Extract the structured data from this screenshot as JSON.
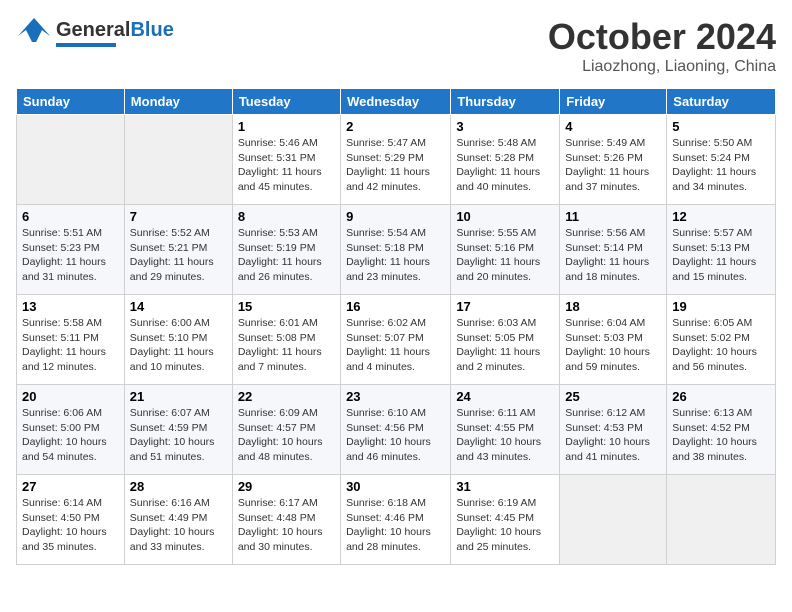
{
  "header": {
    "logo_general": "General",
    "logo_blue": "Blue",
    "month": "October 2024",
    "location": "Liaozhong, Liaoning, China"
  },
  "calendar": {
    "days_of_week": [
      "Sunday",
      "Monday",
      "Tuesday",
      "Wednesday",
      "Thursday",
      "Friday",
      "Saturday"
    ],
    "weeks": [
      [
        {
          "day": "",
          "sunrise": "",
          "sunset": "",
          "daylight": ""
        },
        {
          "day": "",
          "sunrise": "",
          "sunset": "",
          "daylight": ""
        },
        {
          "day": "1",
          "sunrise": "Sunrise: 5:46 AM",
          "sunset": "Sunset: 5:31 PM",
          "daylight": "Daylight: 11 hours and 45 minutes."
        },
        {
          "day": "2",
          "sunrise": "Sunrise: 5:47 AM",
          "sunset": "Sunset: 5:29 PM",
          "daylight": "Daylight: 11 hours and 42 minutes."
        },
        {
          "day": "3",
          "sunrise": "Sunrise: 5:48 AM",
          "sunset": "Sunset: 5:28 PM",
          "daylight": "Daylight: 11 hours and 40 minutes."
        },
        {
          "day": "4",
          "sunrise": "Sunrise: 5:49 AM",
          "sunset": "Sunset: 5:26 PM",
          "daylight": "Daylight: 11 hours and 37 minutes."
        },
        {
          "day": "5",
          "sunrise": "Sunrise: 5:50 AM",
          "sunset": "Sunset: 5:24 PM",
          "daylight": "Daylight: 11 hours and 34 minutes."
        }
      ],
      [
        {
          "day": "6",
          "sunrise": "Sunrise: 5:51 AM",
          "sunset": "Sunset: 5:23 PM",
          "daylight": "Daylight: 11 hours and 31 minutes."
        },
        {
          "day": "7",
          "sunrise": "Sunrise: 5:52 AM",
          "sunset": "Sunset: 5:21 PM",
          "daylight": "Daylight: 11 hours and 29 minutes."
        },
        {
          "day": "8",
          "sunrise": "Sunrise: 5:53 AM",
          "sunset": "Sunset: 5:19 PM",
          "daylight": "Daylight: 11 hours and 26 minutes."
        },
        {
          "day": "9",
          "sunrise": "Sunrise: 5:54 AM",
          "sunset": "Sunset: 5:18 PM",
          "daylight": "Daylight: 11 hours and 23 minutes."
        },
        {
          "day": "10",
          "sunrise": "Sunrise: 5:55 AM",
          "sunset": "Sunset: 5:16 PM",
          "daylight": "Daylight: 11 hours and 20 minutes."
        },
        {
          "day": "11",
          "sunrise": "Sunrise: 5:56 AM",
          "sunset": "Sunset: 5:14 PM",
          "daylight": "Daylight: 11 hours and 18 minutes."
        },
        {
          "day": "12",
          "sunrise": "Sunrise: 5:57 AM",
          "sunset": "Sunset: 5:13 PM",
          "daylight": "Daylight: 11 hours and 15 minutes."
        }
      ],
      [
        {
          "day": "13",
          "sunrise": "Sunrise: 5:58 AM",
          "sunset": "Sunset: 5:11 PM",
          "daylight": "Daylight: 11 hours and 12 minutes."
        },
        {
          "day": "14",
          "sunrise": "Sunrise: 6:00 AM",
          "sunset": "Sunset: 5:10 PM",
          "daylight": "Daylight: 11 hours and 10 minutes."
        },
        {
          "day": "15",
          "sunrise": "Sunrise: 6:01 AM",
          "sunset": "Sunset: 5:08 PM",
          "daylight": "Daylight: 11 hours and 7 minutes."
        },
        {
          "day": "16",
          "sunrise": "Sunrise: 6:02 AM",
          "sunset": "Sunset: 5:07 PM",
          "daylight": "Daylight: 11 hours and 4 minutes."
        },
        {
          "day": "17",
          "sunrise": "Sunrise: 6:03 AM",
          "sunset": "Sunset: 5:05 PM",
          "daylight": "Daylight: 11 hours and 2 minutes."
        },
        {
          "day": "18",
          "sunrise": "Sunrise: 6:04 AM",
          "sunset": "Sunset: 5:03 PM",
          "daylight": "Daylight: 10 hours and 59 minutes."
        },
        {
          "day": "19",
          "sunrise": "Sunrise: 6:05 AM",
          "sunset": "Sunset: 5:02 PM",
          "daylight": "Daylight: 10 hours and 56 minutes."
        }
      ],
      [
        {
          "day": "20",
          "sunrise": "Sunrise: 6:06 AM",
          "sunset": "Sunset: 5:00 PM",
          "daylight": "Daylight: 10 hours and 54 minutes."
        },
        {
          "day": "21",
          "sunrise": "Sunrise: 6:07 AM",
          "sunset": "Sunset: 4:59 PM",
          "daylight": "Daylight: 10 hours and 51 minutes."
        },
        {
          "day": "22",
          "sunrise": "Sunrise: 6:09 AM",
          "sunset": "Sunset: 4:57 PM",
          "daylight": "Daylight: 10 hours and 48 minutes."
        },
        {
          "day": "23",
          "sunrise": "Sunrise: 6:10 AM",
          "sunset": "Sunset: 4:56 PM",
          "daylight": "Daylight: 10 hours and 46 minutes."
        },
        {
          "day": "24",
          "sunrise": "Sunrise: 6:11 AM",
          "sunset": "Sunset: 4:55 PM",
          "daylight": "Daylight: 10 hours and 43 minutes."
        },
        {
          "day": "25",
          "sunrise": "Sunrise: 6:12 AM",
          "sunset": "Sunset: 4:53 PM",
          "daylight": "Daylight: 10 hours and 41 minutes."
        },
        {
          "day": "26",
          "sunrise": "Sunrise: 6:13 AM",
          "sunset": "Sunset: 4:52 PM",
          "daylight": "Daylight: 10 hours and 38 minutes."
        }
      ],
      [
        {
          "day": "27",
          "sunrise": "Sunrise: 6:14 AM",
          "sunset": "Sunset: 4:50 PM",
          "daylight": "Daylight: 10 hours and 35 minutes."
        },
        {
          "day": "28",
          "sunrise": "Sunrise: 6:16 AM",
          "sunset": "Sunset: 4:49 PM",
          "daylight": "Daylight: 10 hours and 33 minutes."
        },
        {
          "day": "29",
          "sunrise": "Sunrise: 6:17 AM",
          "sunset": "Sunset: 4:48 PM",
          "daylight": "Daylight: 10 hours and 30 minutes."
        },
        {
          "day": "30",
          "sunrise": "Sunrise: 6:18 AM",
          "sunset": "Sunset: 4:46 PM",
          "daylight": "Daylight: 10 hours and 28 minutes."
        },
        {
          "day": "31",
          "sunrise": "Sunrise: 6:19 AM",
          "sunset": "Sunset: 4:45 PM",
          "daylight": "Daylight: 10 hours and 25 minutes."
        },
        {
          "day": "",
          "sunrise": "",
          "sunset": "",
          "daylight": ""
        },
        {
          "day": "",
          "sunrise": "",
          "sunset": "",
          "daylight": ""
        }
      ]
    ]
  }
}
